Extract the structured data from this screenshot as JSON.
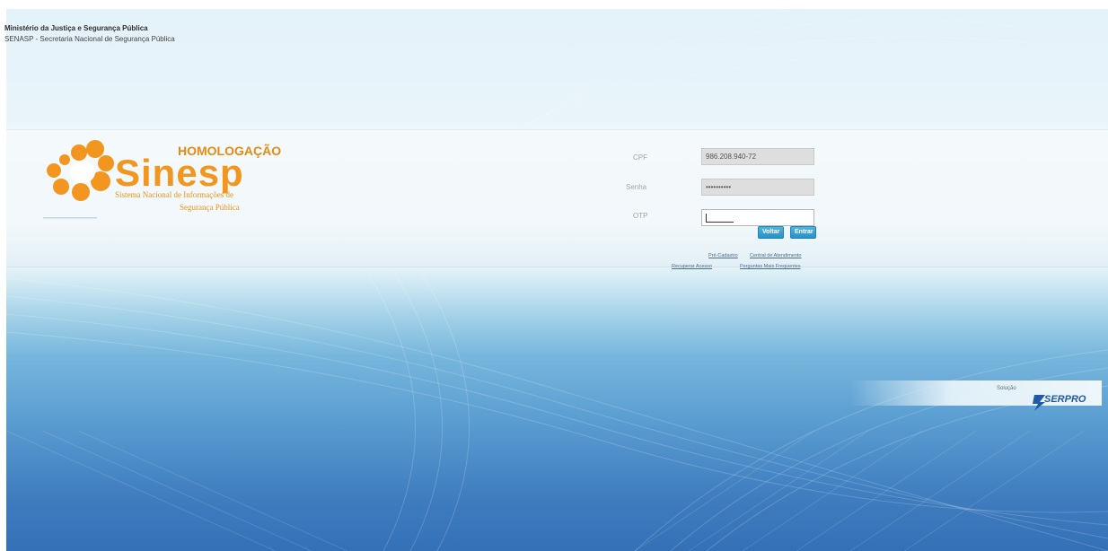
{
  "header": {
    "ministry": "Ministério da Justiça e Segurança Pública",
    "department": "SENASP - Secretaria Nacional de Segurança Pública"
  },
  "logo": {
    "environment": "HOMOLOGAÇÃO",
    "brand": "Sinesp",
    "tagline_line1": "Sistema Nacional de Informações de",
    "tagline_line2": "Segurança Pública",
    "icon": "sinesp-orange-circles-icon"
  },
  "login": {
    "cpf_label": "CPF",
    "cpf_value": "986.208.940-72",
    "password_label": "Senha",
    "password_value": "••••••••••",
    "otp_label": "OTP",
    "otp_value": "",
    "back_button": "Voltar",
    "enter_button": "Entrar",
    "links": {
      "pre_register": "Pré-Cadastro",
      "recover_access": "Recuperar Acesso",
      "support_center": "Central de Atendimento",
      "faq": "Perguntas Mais Frequentes"
    }
  },
  "footer": {
    "solution_label": "Solução",
    "vendor": "SERPRO",
    "vendor_icon": "serpro-logo-icon"
  },
  "colors": {
    "accent_orange": "#f2961f",
    "button_blue": "#2a8fc4",
    "background_blue": "#3470b6",
    "serpro_blue": "#1f5aa6"
  }
}
